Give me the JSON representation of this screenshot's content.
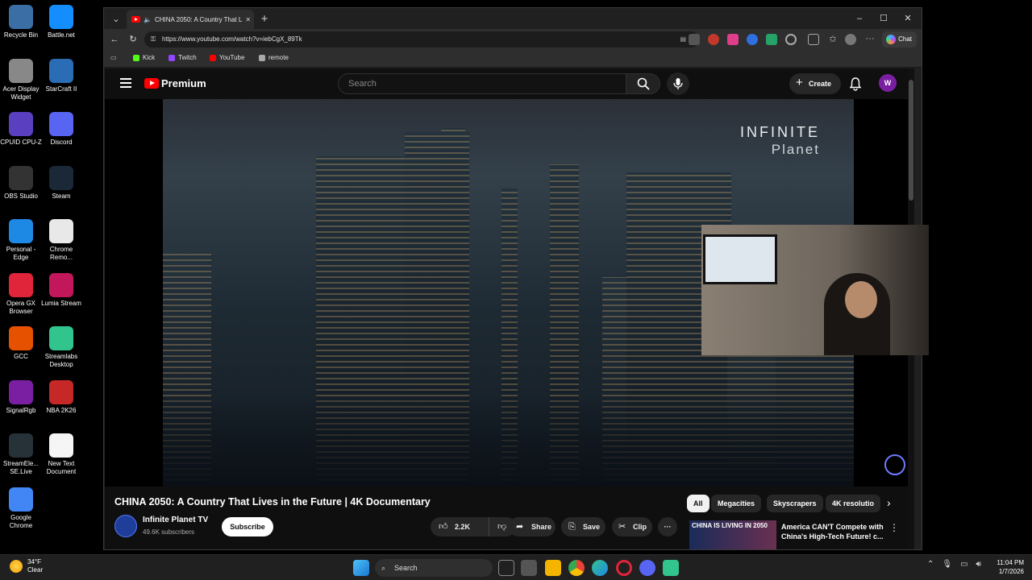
{
  "desktop": {
    "icons": [
      {
        "label": "Recycle Bin",
        "icon": "recycle-bin-icon"
      },
      {
        "label": "Battle.net",
        "icon": "battlenet-icon"
      },
      {
        "label": "Acer Display Widget",
        "icon": "acer-display-widget-icon"
      },
      {
        "label": "StarCraft II",
        "icon": "starcraft-icon"
      },
      {
        "label": "CPUID CPU-Z",
        "icon": "cpuz-icon"
      },
      {
        "label": "Discord",
        "icon": "discord-icon"
      },
      {
        "label": "OBS Studio",
        "icon": "obs-icon"
      },
      {
        "label": "Steam",
        "icon": "steam-icon"
      },
      {
        "label": "Personal - Edge",
        "icon": "edge-icon"
      },
      {
        "label": "Chrome Remo...",
        "icon": "chrome-remote-icon"
      },
      {
        "label": "Opera GX Browser",
        "icon": "opera-gx-icon"
      },
      {
        "label": "Lumia Stream",
        "icon": "lumia-stream-icon"
      },
      {
        "label": "GCC",
        "icon": "gcc-icon"
      },
      {
        "label": "Streamlabs Desktop",
        "icon": "streamlabs-icon"
      },
      {
        "label": "SignalRgb",
        "icon": "signalrgb-icon"
      },
      {
        "label": "NBA 2K26",
        "icon": "nba2k26-icon"
      },
      {
        "label": "StreamEle... SE.Live",
        "icon": "streamelements-icon"
      },
      {
        "label": "New Text Document",
        "icon": "text-document-icon"
      },
      {
        "label": "Google Chrome",
        "icon": "chrome-icon"
      }
    ]
  },
  "browser": {
    "tab_title": "CHINA 2050: A Country That L",
    "url": "https://www.youtube.com/watch?v=iebCgX_89Tk",
    "chat_label": "Chat",
    "favorites": [
      {
        "label": "Kick",
        "color": "#53fc18"
      },
      {
        "label": "Twitch",
        "color": "#9146ff"
      },
      {
        "label": "YouTube",
        "color": "#ff0000"
      },
      {
        "label": "remote",
        "color": "#aaaaaa"
      }
    ]
  },
  "youtube": {
    "logo_text": "Premium",
    "search_placeholder": "Search",
    "create_label": "Create",
    "avatar_letter": "W",
    "watermark_line1": "INFINITE",
    "watermark_line2": "Planet",
    "video_title": "CHINA 2050: A Country That Lives in the Future | 4K Documentary",
    "channel_name": "Infinite Planet TV",
    "subscribers": "49.6K subscribers",
    "subscribe_label": "Subscribe",
    "likes": "2.2K",
    "share_label": "Share",
    "save_label": "Save",
    "clip_label": "Clip",
    "chips": [
      "All",
      "Megacities",
      "Skyscrapers",
      "4K resolutio"
    ],
    "rec_thumb_text": "CHINA IS LIVING IN 2050",
    "rec_title": "America CAN'T Compete with China's High-Tech Future! c..."
  },
  "taskbar": {
    "temp": "34°F",
    "condition": "Clear",
    "search_label": "Search",
    "time": "11:04 PM",
    "date": "1/7/2026"
  }
}
